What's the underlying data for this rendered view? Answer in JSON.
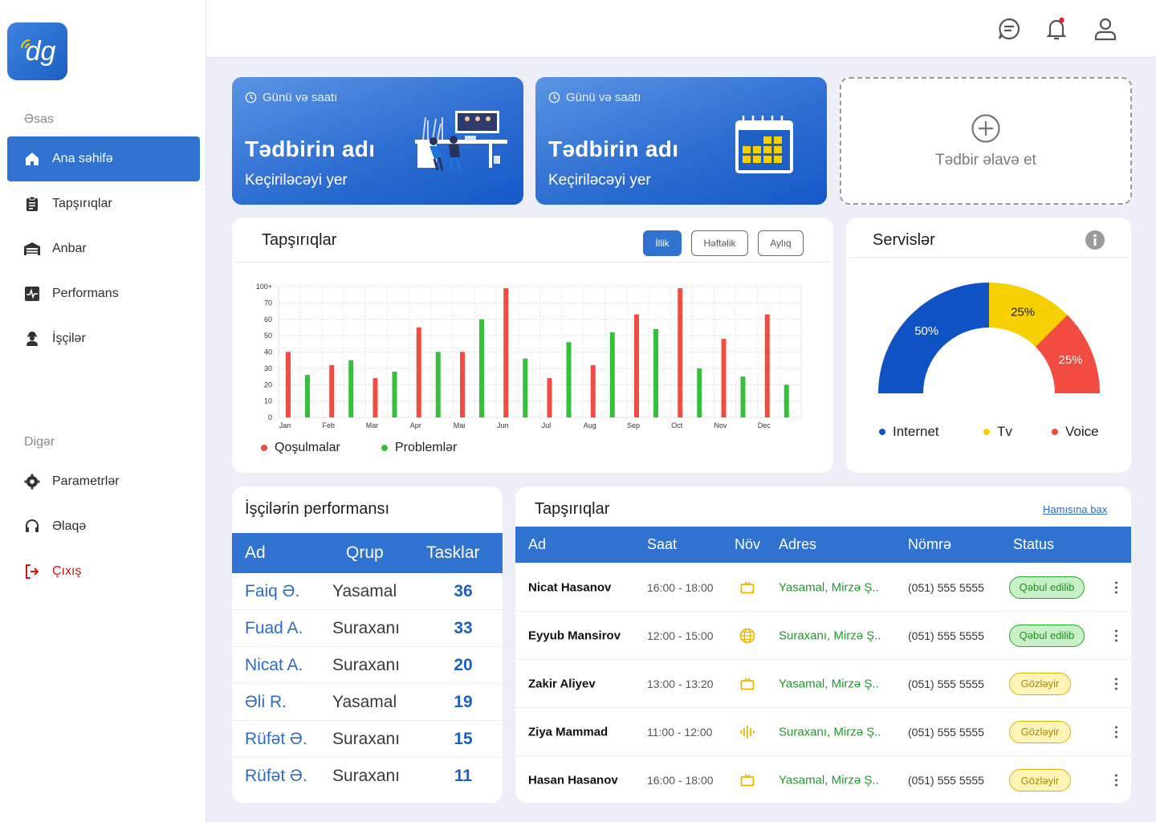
{
  "app": {
    "logo_text": "dg"
  },
  "sidebar": {
    "section_main": "Əsas",
    "section_other": "Digər",
    "items": [
      {
        "label": "Ana səhifə",
        "icon": "home-icon"
      },
      {
        "label": "Tapşırıqlar",
        "icon": "clipboard-icon"
      },
      {
        "label": "Anbar",
        "icon": "warehouse-icon"
      },
      {
        "label": "Performans",
        "icon": "performance-icon"
      },
      {
        "label": "İşçilər",
        "icon": "worker-icon"
      }
    ],
    "other_items": [
      {
        "label": "Parametrlər",
        "icon": "gear-icon"
      },
      {
        "label": "Əlaqə",
        "icon": "headset-icon"
      },
      {
        "label": "Çıxış",
        "icon": "logout-icon"
      }
    ]
  },
  "events": [
    {
      "datetime": "Günü və saatı",
      "title": "Tədbirin adı",
      "place": "Keçiriləcəyi yer"
    },
    {
      "datetime": "Günü və saatı",
      "title": "Tədbirin adı",
      "place": "Keçiriləcəyi yer"
    }
  ],
  "add_event": {
    "label": "Tədbir əlavə et"
  },
  "tasks_chart": {
    "title": "Tapşırıqlar",
    "filters": [
      "İllik",
      "Həftəlik",
      "Aylıq"
    ],
    "active_filter": "İllik",
    "legend": [
      "Qoşulmalar",
      "Problemlər"
    ]
  },
  "chart_data": {
    "type": "bar",
    "categories": [
      "Jan",
      "Feb",
      "Mar",
      "Apr",
      "Mai",
      "Jun",
      "Jul",
      "Aug",
      "Sep",
      "Oct",
      "Nov",
      "Dec"
    ],
    "series": [
      {
        "name": "Qoşulmalar",
        "color": "#f24b3f",
        "values": [
          40,
          32,
          24,
          55,
          40,
          79,
          24,
          32,
          63,
          79,
          48,
          63
        ]
      },
      {
        "name": "Problemlər",
        "color": "#35c03b",
        "values": [
          26,
          35,
          28,
          40,
          60,
          36,
          46,
          52,
          54,
          30,
          25,
          20
        ]
      }
    ],
    "y_ticks": [
      "0",
      "10",
      "20",
      "30",
      "40",
      "50",
      "60",
      "70",
      "100+"
    ],
    "ylim": [
      0,
      80
    ],
    "grid": true,
    "legend_position": "bottom-left"
  },
  "services": {
    "title": "Servislər",
    "legend": [
      {
        "label": "Internet",
        "color": "#0f52c4"
      },
      {
        "label": "Tv",
        "color": "#f7d000"
      },
      {
        "label": "Voice",
        "color": "#f24b3f"
      }
    ],
    "slices": [
      {
        "label": "50%",
        "value": 50,
        "color": "#0f52c4"
      },
      {
        "label": "25%",
        "value": 25,
        "color": "#f7d000"
      },
      {
        "label": "25%",
        "value": 25,
        "color": "#f24b3f"
      }
    ]
  },
  "performance": {
    "title": "İşçilərin performansı",
    "columns": [
      "Ad",
      "Qrup",
      "Tasklar"
    ],
    "rows": [
      {
        "name": "Faiq Ə.",
        "group": "Yasamal",
        "count": "36"
      },
      {
        "name": "Fuad A.",
        "group": "Suraxanı",
        "count": "33"
      },
      {
        "name": "Nicat A.",
        "group": "Suraxanı",
        "count": "20"
      },
      {
        "name": "Əli R.",
        "group": "Yasamal",
        "count": "19"
      },
      {
        "name": "Rüfət Ə.",
        "group": "Suraxanı",
        "count": "15"
      },
      {
        "name": "Rüfət Ə.",
        "group": "Suraxanı",
        "count": "11"
      }
    ]
  },
  "tasks": {
    "title": "Tapşırıqlar",
    "view_all": "Hamısına bax",
    "columns": [
      "Ad",
      "Saat",
      "Növ",
      "Adres",
      "Nömrə",
      "Status"
    ],
    "rows": [
      {
        "name": "Nicat Hasanov",
        "time": "16:00 - 18:00",
        "type": "tv-icon",
        "address": "Yasamal, Mirzə Ş..",
        "phone": "(051) 555 5555",
        "status": "Qəbul edilib",
        "status_kind": "ok"
      },
      {
        "name": "Eyyub Mansirov",
        "time": "12:00 - 15:00",
        "type": "globe-icon",
        "address": "Suraxanı, Mirzə Ş..",
        "phone": "(051) 555 5555",
        "status": "Qəbul edilib",
        "status_kind": "ok"
      },
      {
        "name": "Zakir Aliyev",
        "time": "13:00 - 13:20",
        "type": "tv-icon",
        "address": "Yasamal, Mirzə Ş..",
        "phone": "(051) 555 5555",
        "status": "Gözləyir",
        "status_kind": "wait"
      },
      {
        "name": "Ziya Mammad",
        "time": "11:00 - 12:00",
        "type": "voice-icon",
        "address": "Suraxanı, Mirzə Ş..",
        "phone": "(051) 555 5555",
        "status": "Gözləyir",
        "status_kind": "wait"
      },
      {
        "name": "Hasan Hasanov",
        "time": "16:00 - 18:00",
        "type": "tv-icon",
        "address": "Yasamal, Mirzə Ş..",
        "phone": "(051) 555 5555",
        "status": "Gözləyir",
        "status_kind": "wait"
      }
    ]
  }
}
